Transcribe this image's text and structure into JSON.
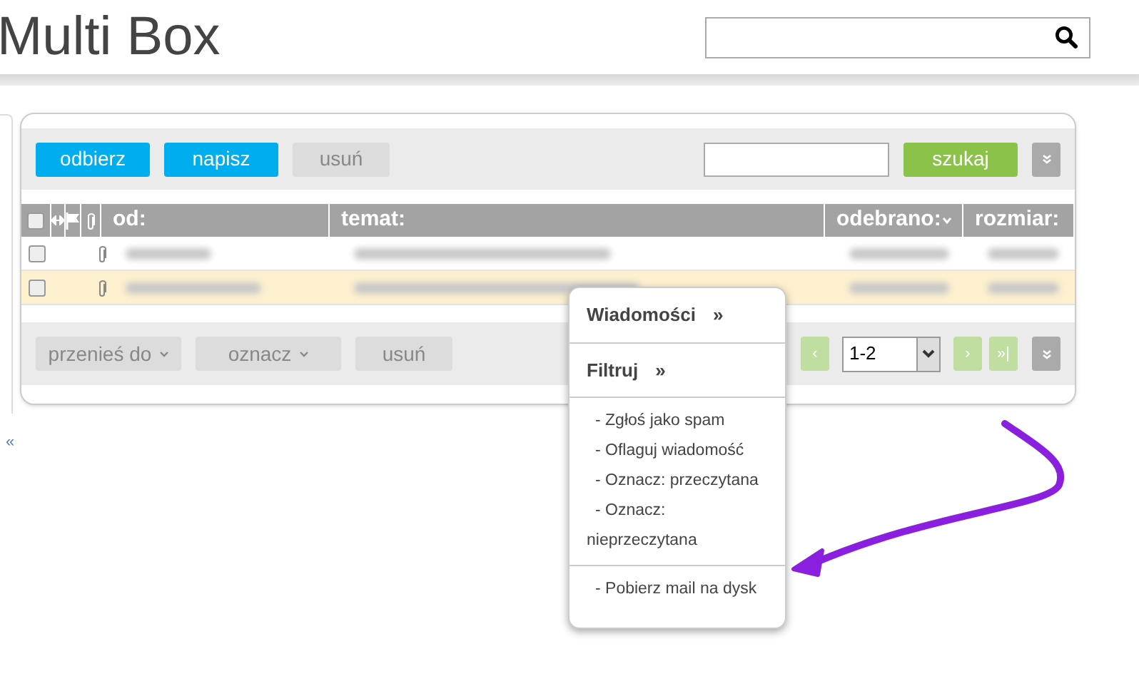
{
  "header": {
    "title": "Multi Box"
  },
  "sidebar": {
    "collapse_label": "«"
  },
  "toolbar": {
    "buttons": [
      {
        "label": "odbierz",
        "disabled": false
      },
      {
        "label": "napisz",
        "disabled": false
      },
      {
        "label": "usuń",
        "disabled": true
      }
    ],
    "search_button": "szukaj"
  },
  "table": {
    "select_all_checked": false,
    "columns": [
      {
        "label": "od:",
        "sorted": false
      },
      {
        "label": "temat:",
        "sorted": false
      },
      {
        "label": "odebrano:",
        "sorted": true
      },
      {
        "label": "rozmiar:",
        "sorted": false
      }
    ],
    "rows": [
      {
        "selected": false,
        "checked": false,
        "attachment": true
      },
      {
        "selected": true,
        "checked": false,
        "attachment": true
      }
    ]
  },
  "bottom_toolbar": {
    "buttons": [
      {
        "label": "przenieś do",
        "kind": "dropdown"
      },
      {
        "label": "oznacz",
        "kind": "dropdown"
      },
      {
        "label": "usuń",
        "kind": "plain"
      }
    ],
    "pagination": {
      "prev": "‹",
      "page": "1-2",
      "next": "›",
      "last": "»|"
    }
  },
  "context_menu": {
    "groups": [
      {
        "items": [
          {
            "label": "Wiadomości",
            "kind": "submenu",
            "arrow": "»"
          }
        ]
      },
      {
        "items": [
          {
            "label": "Filtruj",
            "kind": "submenu",
            "arrow": "»"
          }
        ]
      },
      {
        "items": [
          {
            "label": "- Zgłoś jako spam",
            "kind": "action"
          },
          {
            "label": "- Oflaguj wiadomość",
            "kind": "action"
          },
          {
            "label": "- Oznacz: przeczytana",
            "kind": "action"
          },
          {
            "label": "- Oznacz: nieprzeczytana",
            "kind": "action"
          }
        ]
      },
      {
        "items": [
          {
            "label": "- Pobierz mail na dysk",
            "kind": "action"
          }
        ]
      }
    ]
  }
}
